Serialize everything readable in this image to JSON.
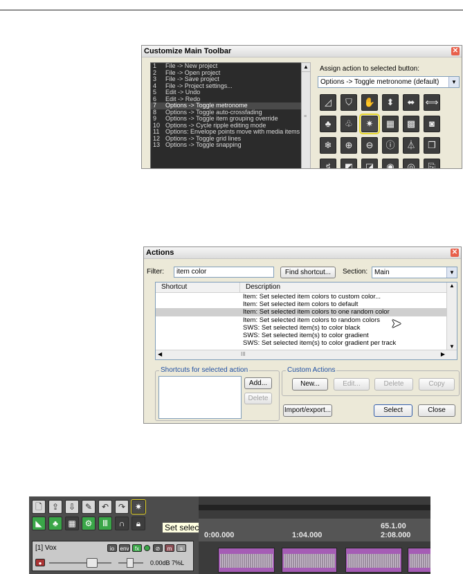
{
  "customize": {
    "title": "Customize Main Toolbar",
    "assign_label": "Assign action to selected button:",
    "assign_value": "Options -> Toggle metronome  (default)",
    "actions": [
      {
        "n": "1",
        "label": "File -> New project"
      },
      {
        "n": "2",
        "label": "File -> Open project"
      },
      {
        "n": "3",
        "label": "File -> Save project"
      },
      {
        "n": "4",
        "label": "File -> Project settings..."
      },
      {
        "n": "5",
        "label": "Edit -> Undo"
      },
      {
        "n": "6",
        "label": "Edit -> Redo"
      },
      {
        "n": "7",
        "label": "Options -> Toggle metronome",
        "selected": true
      },
      {
        "n": "8",
        "label": "Options -> Toggle auto-crossfading"
      },
      {
        "n": "9",
        "label": "Options -> Toggle item grouping override"
      },
      {
        "n": "10",
        "label": "Options -> Cycle ripple editing mode"
      },
      {
        "n": "11",
        "label": "Options: Envelope points move with media items"
      },
      {
        "n": "12",
        "label": "Options -> Toggle grid lines"
      },
      {
        "n": "13",
        "label": "Options -> Toggle snapping"
      }
    ],
    "icons": [
      "triangle-ruler",
      "shield",
      "hand",
      "up-down-arrows",
      "left-right-arrows",
      "width",
      "clubs",
      "clubs-minus",
      "starburst",
      "grid",
      "grid-2",
      "gauge",
      "snowflake",
      "zoom-in",
      "zoom-out",
      "info",
      "metronome",
      "copy",
      "mic-level",
      "grid-level",
      "wave-edit",
      "record",
      "record-2",
      "tag"
    ]
  },
  "actions_win": {
    "title": "Actions",
    "filter_label": "Filter:",
    "filter_value": "item color",
    "find_shortcut": "Find shortcut...",
    "section_label": "Section:",
    "section_value": "Main",
    "col_shortcut": "Shortcut",
    "col_description": "Description",
    "rows": [
      {
        "desc": "Item: Set selected item colors to custom color..."
      },
      {
        "desc": "Item: Set selected item colors to default"
      },
      {
        "desc": "Item: Set selected item colors to one random color",
        "selected": true
      },
      {
        "desc": "Item: Set selected item colors to random colors"
      },
      {
        "desc": "SWS: Set selected item(s) to color black"
      },
      {
        "desc": "SWS: Set selected item(s) to color gradient"
      },
      {
        "desc": "SWS: Set selected item(s) to color gradient per track"
      }
    ],
    "hscroll_grip": "III",
    "shortcuts_group": "Shortcuts for selected action",
    "add": "Add...",
    "delete_shortcut": "Delete",
    "custom_group": "Custom Actions",
    "new": "New...",
    "edit": "Edit...",
    "delete": "Delete",
    "copy": "Copy",
    "import_export": "Import/export...",
    "select": "Select",
    "close": "Close"
  },
  "reaper": {
    "tooltip": "Set selected item colors to one random color",
    "time1_a": "0:00.000",
    "time2_a": "1:04.000",
    "time3_a": "65.1.00",
    "time3_b": "2:08.000",
    "track_name": "[1]  Vox",
    "volume": "0.00dB 7%L",
    "io": "io",
    "env": "env",
    "fx": "fx",
    "m": "m",
    "s": "s"
  }
}
